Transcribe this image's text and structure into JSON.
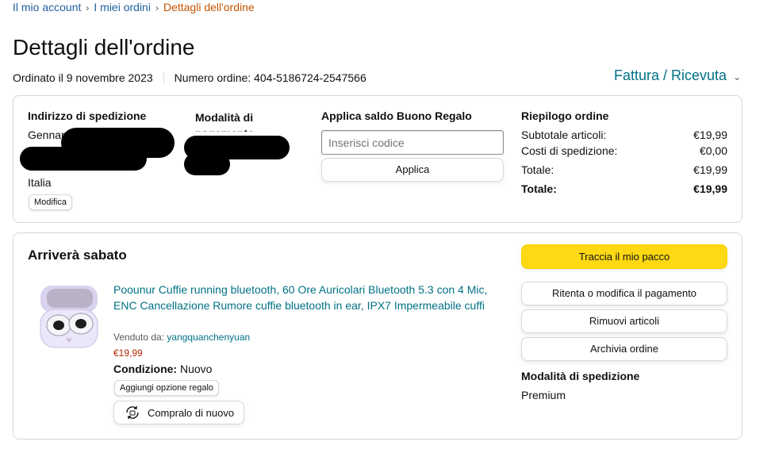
{
  "breadcrumb": {
    "items": [
      "Il mio account",
      "I miei ordini",
      "Dettagli dell'ordine"
    ],
    "separator": "›"
  },
  "page_title": "Dettagli dell'ordine",
  "order_meta": {
    "ordered": "Ordinato il 9 novembre 2023",
    "number": "Numero ordine: 404-5186724-2547566"
  },
  "invoice": {
    "label": "Fattura / Ricevuta",
    "icon": "chevron-down-icon"
  },
  "summary": {
    "shipping": {
      "heading": "Indirizzo di spedizione",
      "name": "Gennaro",
      "country": "Italia",
      "edit": "Modifica"
    },
    "payment": {
      "heading": "Modalità di pagamento"
    },
    "gift": {
      "heading": "Applica saldo Buono Regalo",
      "placeholder": "Inserisci codice",
      "apply": "Applica"
    },
    "totals": {
      "heading": "Riepilogo ordine",
      "rows": [
        {
          "label": "Subtotale articoli:",
          "value": "€19,99"
        },
        {
          "label": "Costi di spedizione:",
          "value": "€0,00"
        },
        {
          "label": "Totale:",
          "value": "€19,99"
        },
        {
          "label": "Totale:",
          "value": "€19,99"
        }
      ]
    }
  },
  "shipment": {
    "arrival": "Arriverà sabato",
    "product": {
      "title": "Poounur Cuffie running bluetooth, 60 Ore Auricolari Bluetooth 5.3 con 4 Mic, ENC Cancellazione Rumore cuffie bluetooth in ear, IPX7 Impermeabile cuffi",
      "sold_by_label": "Venduto da:",
      "seller": "yangquanchenyuan",
      "price": "€19,99",
      "condition_label": "Condizione:",
      "condition": "Nuovo",
      "gift_option": "Aggiungi opzione regalo",
      "buy_again": "Compralo di nuovo"
    },
    "actions": {
      "track": "Traccia il mio pacco",
      "retry_payment": "Ritenta o modifica il pagamento",
      "remove": "Rimuovi articoli",
      "archive": "Archivia ordine"
    },
    "shipping_method": {
      "heading": "Modalità di spedizione",
      "value": "Premium"
    }
  },
  "colors": {
    "link": "#007185",
    "breadcrumb_link": "#2162a1",
    "breadcrumb_current": "#c45500",
    "price": "#b12704",
    "track_button": "#ffd814",
    "border": "#d5d9d9"
  }
}
